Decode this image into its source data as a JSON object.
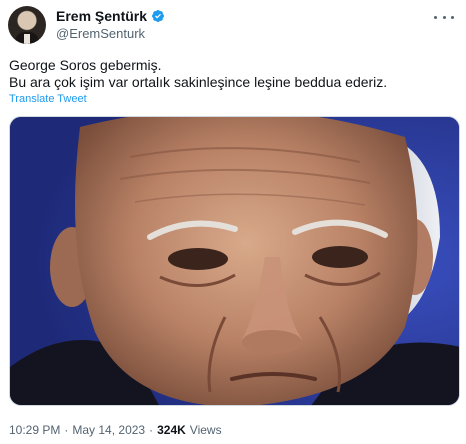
{
  "author": {
    "display_name": "Erem Şentürk",
    "handle": "@EremSenturk",
    "verified": true,
    "verified_color": "#1d9bf0"
  },
  "tweet": {
    "lines": [
      "George Soros gebermiş.",
      "Bu ara çok işim var ortalık sakinleşince leşine beddua ederiz."
    ],
    "translate_label": "Translate Tweet"
  },
  "footer": {
    "time": "10:29 PM",
    "separator": "·",
    "date": "May 14, 2023",
    "views_count": "324K",
    "views_label": "Views"
  },
  "icons": {
    "more": "more-horizontal-icon",
    "verified": "verified-badge-icon"
  },
  "colors": {
    "accent": "#1d9bf0",
    "text_primary": "#0f1419",
    "text_secondary": "#536471",
    "photo_background": "#2b3b9a"
  }
}
